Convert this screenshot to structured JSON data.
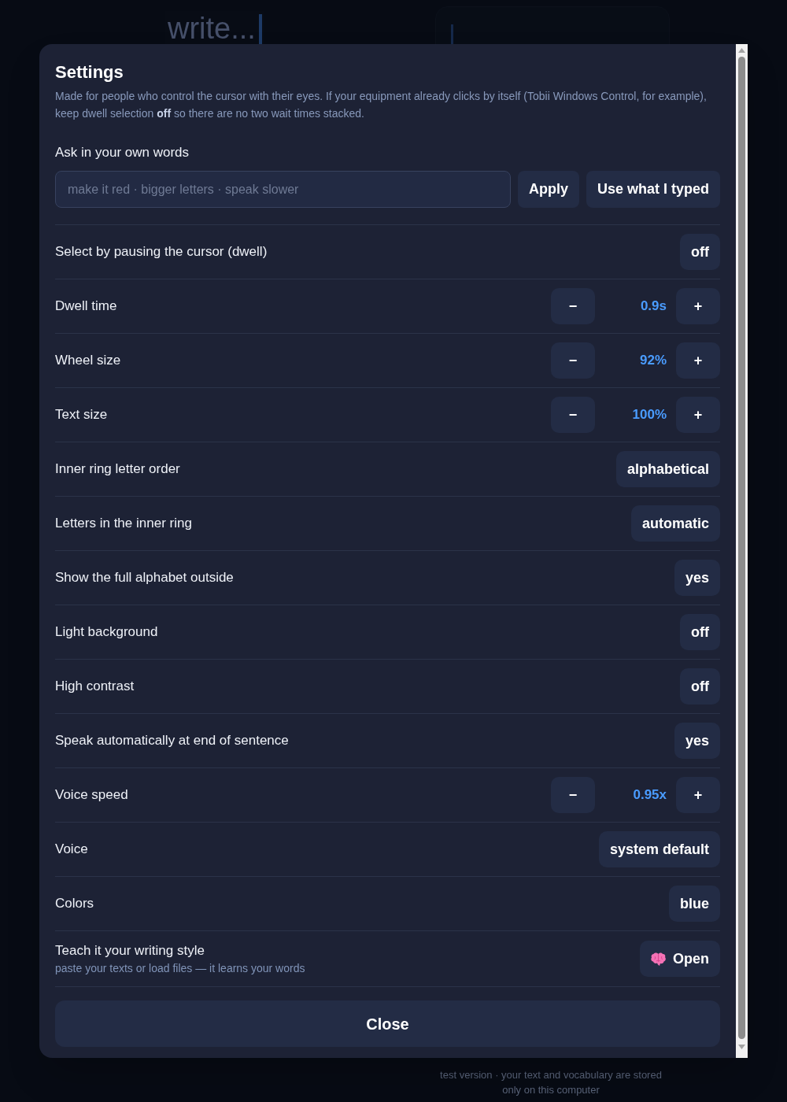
{
  "background": {
    "editor_placeholder": "write...",
    "footer": "test version · your text and vocabulary are stored only on this computer"
  },
  "dialog": {
    "title": "Settings",
    "description": "Made for people who control the cursor with their eyes. If your equipment already clicks by itself (Tobii Windows Control, for example), keep dwell selection **off** so there are no two wait times stacked.",
    "ask": {
      "label": "Ask in your own words",
      "placeholder": "make it red · bigger letters · speak slower",
      "buttons": [
        "Apply",
        "Use what I typed"
      ]
    },
    "settings": [
      {
        "kind": "choice",
        "label": "Select by pausing the cursor (dwell)",
        "value": "off"
      },
      {
        "kind": "stepper",
        "label": "Dwell time",
        "decrease": "−",
        "value": "0.9s",
        "increase": "+"
      },
      {
        "kind": "stepper",
        "label": "Wheel size",
        "decrease": "−",
        "value": "92%",
        "increase": "+"
      },
      {
        "kind": "stepper",
        "label": "Text size",
        "decrease": "−",
        "value": "100%",
        "increase": "+"
      },
      {
        "kind": "choice",
        "label": "Inner ring letter order",
        "value": "alphabetical"
      },
      {
        "kind": "choice",
        "label": "Letters in the inner ring",
        "value": "automatic"
      },
      {
        "kind": "choice",
        "label": "Show the full alphabet outside",
        "value": "yes"
      },
      {
        "kind": "choice",
        "label": "Light background",
        "value": "off"
      },
      {
        "kind": "choice",
        "label": "High contrast",
        "value": "off"
      },
      {
        "kind": "choice",
        "label": "Speak automatically at end of sentence",
        "value": "yes"
      },
      {
        "kind": "stepper",
        "label": "Voice speed",
        "decrease": "−",
        "value": "0.95x",
        "increase": "+"
      },
      {
        "kind": "choice",
        "label": "Voice",
        "value": "system default"
      },
      {
        "kind": "choice",
        "label": "Colors",
        "value": "blue"
      },
      {
        "kind": "action",
        "label": "Teach it your writing style",
        "hint": "paste your texts or load files — it learns your words",
        "button": "Open"
      }
    ],
    "close": "Close"
  }
}
